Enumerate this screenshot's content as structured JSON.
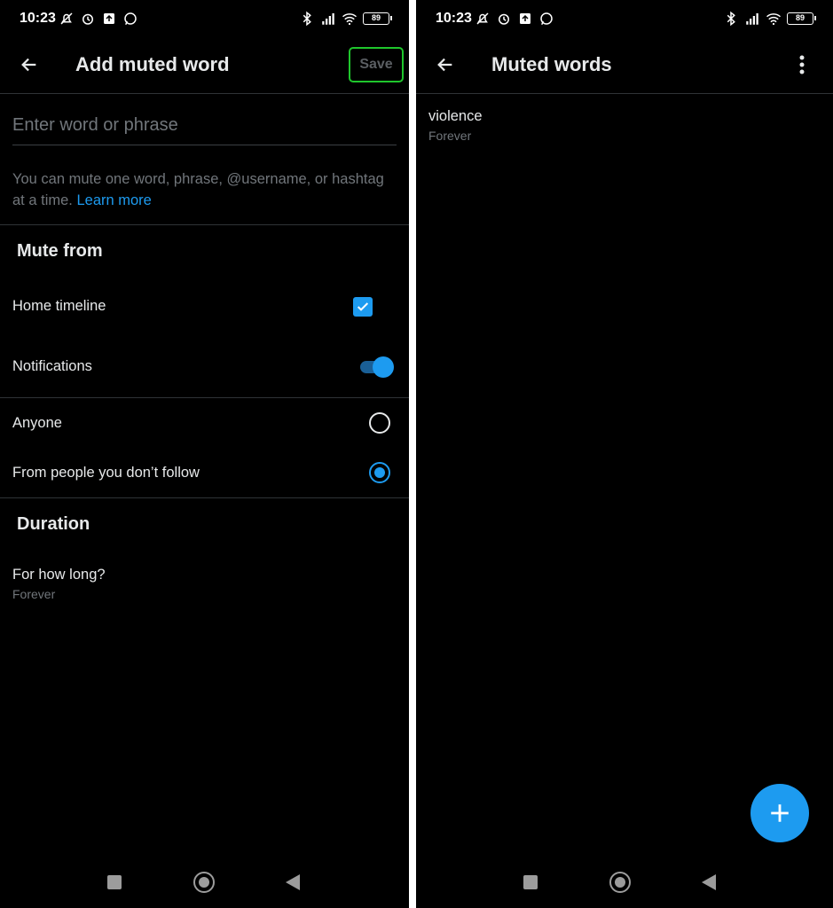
{
  "status_bar": {
    "time": "10:23",
    "battery": "89"
  },
  "left_screen": {
    "title": "Add muted word",
    "save_label": "Save",
    "input_placeholder": "Enter word or phrase",
    "help_text": "You can mute one word, phrase, @username, or hashtag at a time.",
    "learn_more": "Learn more",
    "mute_from": {
      "title": "Mute from",
      "home_timeline": "Home timeline",
      "home_timeline_checked": true,
      "notifications": "Notifications",
      "notifications_on": true,
      "anyone": "Anyone",
      "from_people": "From people you don’t follow",
      "selected_audience": "From people you don’t follow"
    },
    "duration": {
      "title": "Duration",
      "question": "For how long?",
      "value": "Forever"
    }
  },
  "right_screen": {
    "title": "Muted words",
    "items": [
      {
        "word": "violence",
        "duration": "Forever"
      }
    ]
  },
  "colors": {
    "accent": "#1d9bf0",
    "save_highlight": "#1fc62c",
    "background": "#000000",
    "text_primary": "#e7e9ea",
    "text_secondary": "#71767b"
  },
  "icons": {
    "back": "arrow-left-icon",
    "overflow": "more-vertical-icon",
    "fab": "plus-icon",
    "checkbox": "check-icon"
  }
}
